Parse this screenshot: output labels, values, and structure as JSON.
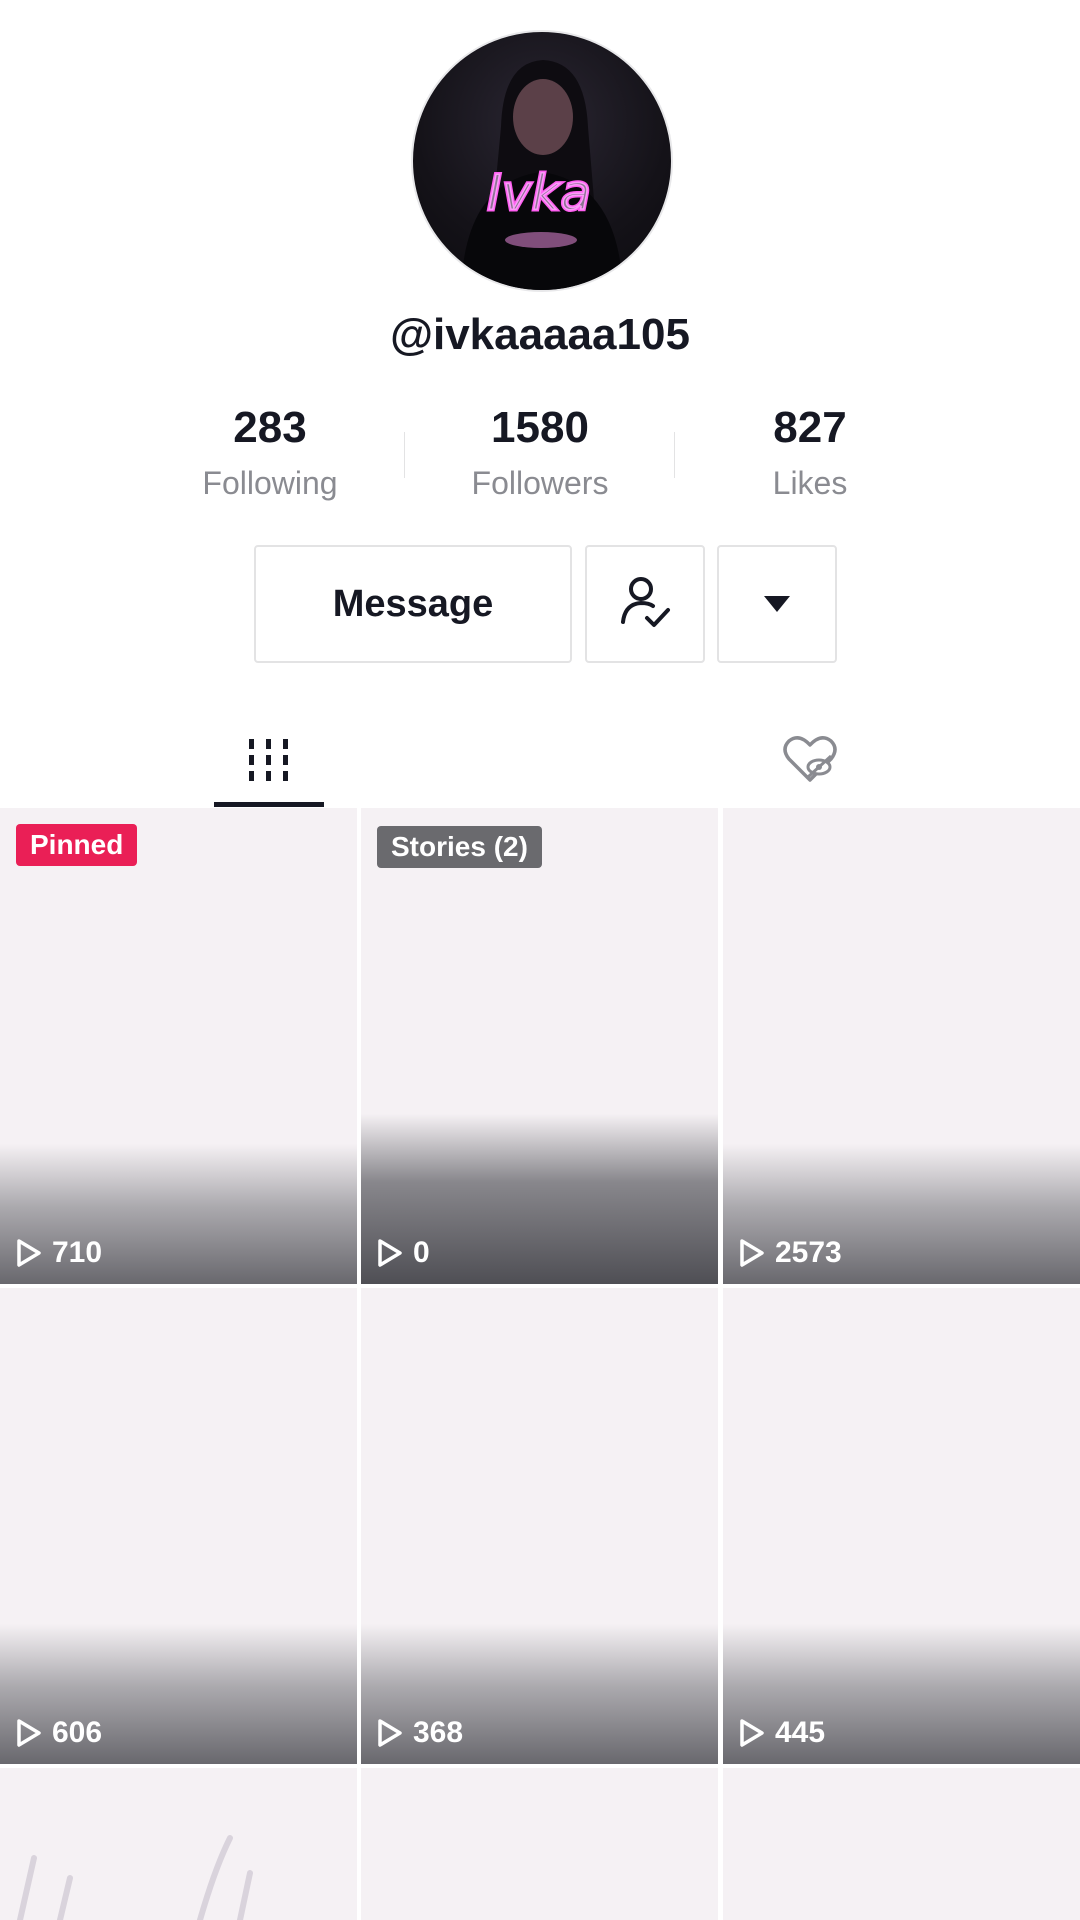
{
  "profile": {
    "username": "@ivkaaaaa105",
    "avatar_text": "Ivka",
    "stats": [
      {
        "value": "283",
        "label": "Following"
      },
      {
        "value": "1580",
        "label": "Followers"
      },
      {
        "value": "827",
        "label": "Likes"
      }
    ]
  },
  "actions": {
    "message_label": "Message",
    "follow_icon": "user-check-icon",
    "more_icon": "caret-down-icon"
  },
  "tabs": [
    {
      "icon": "grid-icon",
      "active": true
    },
    {
      "icon": "liked-hidden-icon",
      "active": false
    }
  ],
  "videos": [
    {
      "views": "710",
      "badge": "Pinned"
    },
    {
      "views": "0",
      "badge": "Stories (2)"
    },
    {
      "views": "2573",
      "badge": ""
    },
    {
      "views": "606",
      "badge": ""
    },
    {
      "views": "368",
      "badge": ""
    },
    {
      "views": "445",
      "badge": ""
    },
    {
      "views": "",
      "badge": ""
    },
    {
      "views": "",
      "badge": ""
    },
    {
      "views": "",
      "badge": ""
    }
  ],
  "colors": {
    "pinned": "#ea1f56",
    "stories": "#6a6a6e",
    "text_primary": "#161823",
    "text_secondary": "#8a8b91"
  }
}
